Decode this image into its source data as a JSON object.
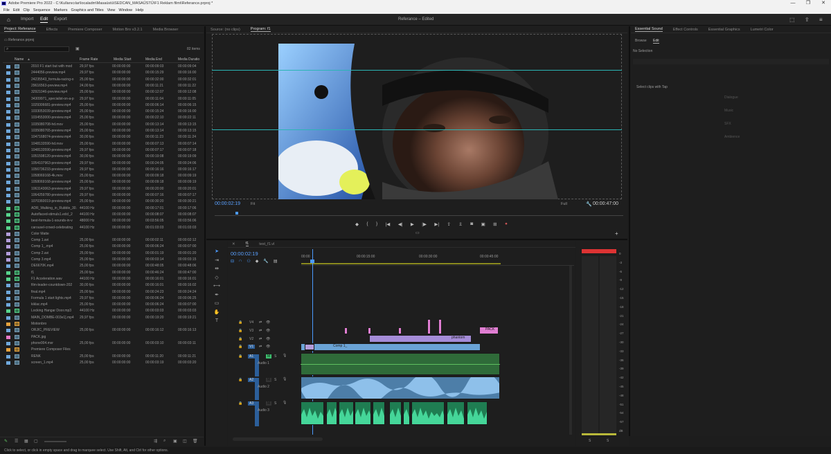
{
  "window": {
    "title": "Adobe Premiere Pro 2022 - C:\\Kullanıcılar\\localadm\\Masaüstü\\SEDCAN_MASAÜSTÜ\\F1 Reklam filmi\\Referance.prproj *",
    "min": "—",
    "restore": "❐",
    "close": "✕"
  },
  "menu": [
    "File",
    "Edit",
    "Clip",
    "Sequence",
    "Markers",
    "Graphics and Titles",
    "View",
    "Window",
    "Help"
  ],
  "workspaces": {
    "import": "Import",
    "edit": "Edit",
    "export": "Export"
  },
  "header_center": "Referance  –  Edited",
  "project": {
    "tabs": [
      "Project: Referance",
      "Effects",
      "Premiere Composer",
      "Motion Bro v3.2.1",
      "Media Browser"
    ],
    "path": "Referance.prproj",
    "search_placeholder": "",
    "item_count": "82 items",
    "columns": [
      "Name",
      "Frame Rate",
      "Media Start",
      "Media End",
      "Media Duratio"
    ],
    "items": [
      {
        "name": "2010 F1 start but with mod",
        "fps": "29,97 fps",
        "start": "00:00:00:00",
        "end": "00:00:09:03",
        "dur": "00:00:09:04",
        "color": "#6fa8dc"
      },
      {
        "name": "2444056-preview.mp4",
        "fps": "29,97 fps",
        "start": "00:00:00:00",
        "end": "00:00:15:29",
        "dur": "00:00:16:00",
        "color": "#6fa8dc"
      },
      {
        "name": "24235543_formula-racing-o",
        "fps": "25,00 fps",
        "start": "00:00:00:00",
        "end": "00:00:32:00",
        "dur": "00:00:32:01",
        "color": "#6fa8dc"
      },
      {
        "name": "29616563-preview.mp4",
        "fps": "24,00 fps",
        "start": "00:00:00:00",
        "end": "00:00:11:21",
        "dur": "00:00:11:22",
        "color": "#6fa8dc"
      },
      {
        "name": "32921046-preview.mp4",
        "fps": "25,00 fps",
        "start": "00:00:00:00",
        "end": "00:00:12:07",
        "dur": "00:00:12:08",
        "color": "#6fa8dc"
      },
      {
        "name": "34309971_specialist-on-a-p",
        "fps": "29,97 fps",
        "start": "00:00:00:00",
        "end": "00:00:11:04",
        "dur": "00:00:11:05",
        "color": "#6fa8dc"
      },
      {
        "name": "1029306681-preview.mp4",
        "fps": "25,00 fps",
        "start": "00:00:00:00",
        "end": "00:00:06:14",
        "dur": "00:00:06:15",
        "color": "#6fa8dc"
      },
      {
        "name": "1033053039-preview.mp4",
        "fps": "25,00 fps",
        "start": "00:00:00:00",
        "end": "00:00:15:24",
        "dur": "00:00:16:00",
        "color": "#6fa8dc"
      },
      {
        "name": "1034553000-preview.mp4",
        "fps": "25,00 fps",
        "start": "00:00:00:00",
        "end": "00:00:22:10",
        "dur": "00:00:22:11",
        "color": "#6fa8dc"
      },
      {
        "name": "1035080708-hd.mov",
        "fps": "25,00 fps",
        "start": "00:00:00:00",
        "end": "00:00:13:14",
        "dur": "00:00:13:15",
        "color": "#6fa8dc"
      },
      {
        "name": "1035080765-preview.mp4",
        "fps": "25,00 fps",
        "start": "00:00:00:00",
        "end": "00:00:13:14",
        "dur": "00:00:13:15",
        "color": "#6fa8dc"
      },
      {
        "name": "1047168074-preview.mp4",
        "fps": "30,00 fps",
        "start": "00:00:00:00",
        "end": "00:00:11:23",
        "dur": "00:00:11:24",
        "color": "#6fa8dc"
      },
      {
        "name": "1048133590-hd.mov",
        "fps": "25,00 fps",
        "start": "00:00:00:00",
        "end": "00:00:07:13",
        "dur": "00:00:07:14",
        "color": "#6fa8dc"
      },
      {
        "name": "1048133590-preview.mp4",
        "fps": "29,97 fps",
        "start": "00:00:00:00",
        "end": "00:00:07:17",
        "dur": "00:00:07:18",
        "color": "#6fa8dc"
      },
      {
        "name": "1051598120-preview.mp4",
        "fps": "30,00 fps",
        "start": "00:00:00:00",
        "end": "00:00:19:08",
        "dur": "00:00:19:09",
        "color": "#6fa8dc"
      },
      {
        "name": "1054107963-preview.mp4",
        "fps": "29,97 fps",
        "start": "00:00:00:00",
        "end": "00:00:24:05",
        "dur": "00:00:24:06",
        "color": "#6fa8dc"
      },
      {
        "name": "1056736233-preview.mp4",
        "fps": "29,97 fps",
        "start": "00:00:00:00",
        "end": "00:00:16:16",
        "dur": "00:00:16:17",
        "color": "#6fa8dc"
      },
      {
        "name": "1058069168-4k.mov",
        "fps": "25,00 fps",
        "start": "00:00:00:00",
        "end": "00:00:09:18",
        "dur": "00:00:09:19",
        "color": "#6fa8dc"
      },
      {
        "name": "1058069168-preview.mp4",
        "fps": "25,00 fps",
        "start": "00:00:00:00",
        "end": "00:00:09:18",
        "dur": "00:00:09:19",
        "color": "#6fa8dc"
      },
      {
        "name": "1063143063-preview.mp4",
        "fps": "29,97 fps",
        "start": "00:00:00:00",
        "end": "00:00:20:00",
        "dur": "00:00:20:01",
        "color": "#6fa8dc"
      },
      {
        "name": "1064259780-preview.mp4",
        "fps": "29,97 fps",
        "start": "00:00:00:00",
        "end": "00:00:07:16",
        "dur": "00:00:07:17",
        "color": "#6fa8dc"
      },
      {
        "name": "1070360019-preview.mp4",
        "fps": "25,00 fps",
        "start": "00:00:00:00",
        "end": "00:00:30:20",
        "dur": "00:00:30:21",
        "color": "#6fa8dc"
      },
      {
        "name": "ADR_Walking_in_Rubble_30.",
        "fps": "44100 Hz",
        "start": "00:00:00:00",
        "end": "00:00:17:01",
        "dur": "00:00:17:06",
        "color": "#57d38c"
      },
      {
        "name": "Autoflaced-stimuls1.edcl_2",
        "fps": "44100 Hz",
        "start": "00:00:00:00",
        "end": "00:00:08:07",
        "dur": "00:00:08:07",
        "color": "#57d38c"
      },
      {
        "name": "best-formula-1-sounds-in-v",
        "fps": "48000 Hz",
        "start": "00:00:00:00",
        "end": "00:03:56:05",
        "dur": "00:03:56:06",
        "color": "#57d38c"
      },
      {
        "name": "carousel-crowd-celebrating",
        "fps": "44100 Hz",
        "start": "00:00:00:00",
        "end": "00:01:03:03",
        "dur": "00:01:03:03",
        "color": "#57d38c"
      },
      {
        "name": "Color Matte",
        "fps": "",
        "start": "",
        "end": "",
        "dur": "",
        "color": "#b39ddb"
      },
      {
        "name": "Comp 1.avi",
        "fps": "25,00 fps",
        "start": "00:00:00:00",
        "end": "00:00:02:11",
        "dur": "00:00:02:12",
        "color": "#b39ddb"
      },
      {
        "name": "Comp 1_.mp4",
        "fps": "25,00 fps",
        "start": "00:00:00:00",
        "end": "00:00:06:24",
        "dur": "00:00:07:00",
        "color": "#b39ddb"
      },
      {
        "name": "Comp 2.avi",
        "fps": "25,00 fps",
        "start": "00:00:00:00",
        "end": "00:00:01:19",
        "dur": "00:00:01:20",
        "color": "#b39ddb"
      },
      {
        "name": "Comp 3.mp4",
        "fps": "25,00 fps",
        "start": "00:00:00:00",
        "end": "00:00:03:14",
        "dur": "00:00:03:15",
        "color": "#b39ddb"
      },
      {
        "name": "DE6670K.mp4",
        "fps": "25,00 fps",
        "start": "00:00:00:00",
        "end": "00:00:48:05",
        "dur": "00:00:48:06",
        "color": "#6fa8dc"
      },
      {
        "name": "f1",
        "fps": "25,00 fps",
        "start": "00:00:00:00",
        "end": "00:00:46:24",
        "dur": "00:00:47:00",
        "color": "#57d38c"
      },
      {
        "name": "F1 Acceleration.wav",
        "fps": "44100 Hz",
        "start": "00:00:00:00",
        "end": "00:00:16:01",
        "dur": "00:00:16:01",
        "color": "#57d38c"
      },
      {
        "name": "film-leader-countdown-202",
        "fps": "30,00 fps",
        "start": "00:00:00:00",
        "end": "00:00:16:01",
        "dur": "00:00:16:02",
        "color": "#6fa8dc"
      },
      {
        "name": "final.mp4",
        "fps": "25,00 fps",
        "start": "00:00:00:00",
        "end": "00:00:24:23",
        "dur": "00:00:24:24",
        "color": "#6fa8dc"
      },
      {
        "name": "Formula 1 start lights.mp4",
        "fps": "29,97 fps",
        "start": "00:00:00:00",
        "end": "00:00:06:24",
        "dur": "00:00:06:25",
        "color": "#6fa8dc"
      },
      {
        "name": "kiklac.mp4",
        "fps": "25,00 fps",
        "start": "00:00:00:00",
        "end": "00:00:06:24",
        "dur": "00:00:07:00",
        "color": "#6fa8dc"
      },
      {
        "name": "Locking Hangar Door.mp3",
        "fps": "44100 Hz",
        "start": "00:00:00:00",
        "end": "00:00:03:03",
        "dur": "00:00:03:03",
        "color": "#57d38c"
      },
      {
        "name": "MAIN_DOMBE-003e1].mp4",
        "fps": "29,97 fps",
        "start": "00:00:00:00",
        "end": "00:00:19:20",
        "dur": "00:00:19:21",
        "color": "#6fa8dc"
      },
      {
        "name": "Motionbro",
        "fps": "",
        "start": "",
        "end": "",
        "dur": "",
        "color": "#e6a23c"
      },
      {
        "name": "ORJIC_PREVIEW",
        "fps": "25,00 fps",
        "start": "00:00:00:00",
        "end": "00:00:16:12",
        "dur": "00:00:16:13",
        "color": "#6fa8dc"
      },
      {
        "name": "PACK.jpg",
        "fps": "",
        "start": "",
        "end": "",
        "dur": "",
        "color": "#e879c7"
      },
      {
        "name": "phone004.mxr",
        "fps": "25,00 fps",
        "start": "00:00:00:00",
        "end": "00:00:03:10",
        "dur": "00:00:03:11",
        "color": "#6fa8dc"
      },
      {
        "name": "Premiere Composer Files",
        "fps": "",
        "start": "",
        "end": "",
        "dur": "",
        "color": "#e6a23c"
      },
      {
        "name": "RENK",
        "fps": "25,00 fps",
        "start": "00:00:00:00",
        "end": "00:00:11:20",
        "dur": "00:00:11:21",
        "color": "#6fa8dc"
      },
      {
        "name": "screen_1.mp4",
        "fps": "25,00 fps",
        "start": "00:00:00:00",
        "end": "00:00:03:19",
        "dur": "00:00:03:20",
        "color": "#6fa8dc"
      }
    ]
  },
  "source_tabs": [
    "Source: (no clips)",
    "Program: f1"
  ],
  "program": {
    "timecode": "00:00:02:19",
    "fit": "Fit",
    "quality": "Full",
    "duration": "00:00:47:00",
    "colors": {
      "timecode": "#4c9bff",
      "guides": "#2bb5b5"
    }
  },
  "timeline": {
    "tab": "f1",
    "secondary_tab": "test_f1.vl",
    "timecode": "00:00:02:19",
    "ruler": [
      "00:00",
      "00:00:15:00",
      "00:00:30:00",
      "00:00:45:00"
    ],
    "tracks": [
      {
        "id": "V4",
        "name": ""
      },
      {
        "id": "V3",
        "name": ""
      },
      {
        "id": "V2",
        "name": ""
      },
      {
        "id": "V1",
        "name": ""
      },
      {
        "id": "A1",
        "name": "Audio 1"
      },
      {
        "id": "A2",
        "name": "Audio 2"
      },
      {
        "id": "A3",
        "name": "Audio 3"
      }
    ],
    "mix": "Mix",
    "mix_value": "0.0",
    "clip_labels": {
      "comp": "Comp 1_",
      "phantom": "phantom",
      "pack": "PACK"
    },
    "colors": {
      "audio1": "#2f6b39",
      "audio2": "#4d7ea8",
      "audio3": "#27a168",
      "video_purple": "#a58cd8",
      "video_blue": "#6aa3d6",
      "video_pink": "#e07ed2"
    }
  },
  "essential_sound": {
    "tabs": [
      "Essential Sound",
      "Effect Controls",
      "Essential Graphics",
      "Lumetri Color"
    ],
    "subtabs": [
      "Browse",
      "Edit"
    ],
    "no_selection": "No Selection",
    "hint": "Select clips with Tap",
    "options": [
      "Dialogue",
      "Music",
      "SFX",
      "Ambience"
    ]
  },
  "meter": {
    "labels": [
      "0",
      "-3",
      "-6",
      "-9",
      "-12",
      "-15",
      "-18",
      "-21",
      "-24",
      "-27",
      "-30",
      "-33",
      "-36",
      "-39",
      "-42",
      "-45",
      "-48",
      "-51",
      "-54",
      "-57",
      "dB"
    ],
    "solo": [
      "S",
      "S"
    ]
  },
  "status": "Click to select, or click in empty space and drag to marquee select. Use Shift, Alt, and Ctrl for other options."
}
